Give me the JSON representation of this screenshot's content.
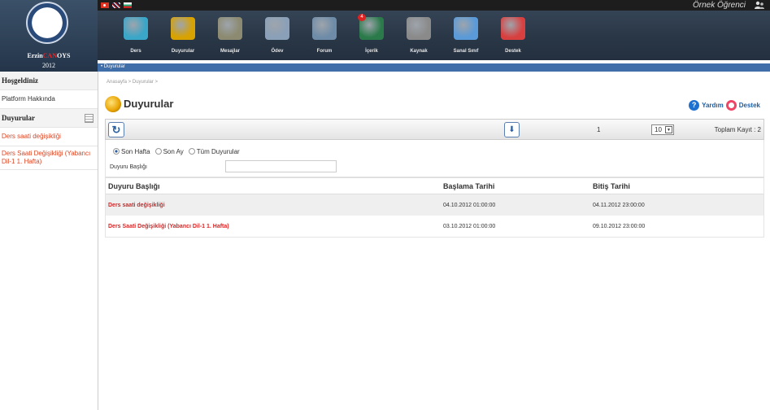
{
  "user": {
    "name": "Örnek Öğrenci"
  },
  "logo": {
    "title_prefix": "Erzin",
    "title_accent": "CAN",
    "title_suffix": "OYS",
    "year": "2012"
  },
  "nav": [
    {
      "label": "Ders",
      "icon": "abc-icon",
      "color": "#3aa6c8"
    },
    {
      "label": "Duyurular",
      "icon": "megaphone-icon",
      "color": "#d8a200"
    },
    {
      "label": "Mesajlar",
      "icon": "mail-icon",
      "color": "#8c8a70"
    },
    {
      "label": "Ödev",
      "icon": "assignment-icon",
      "color": "#8aa0b8"
    },
    {
      "label": "Forum",
      "icon": "forum-icon",
      "color": "#6e8ca8"
    },
    {
      "label": "İçerik",
      "icon": "blackboard-icon",
      "color": "#2a7a4a",
      "badge": "4"
    },
    {
      "label": "Kaynak",
      "icon": "books-icon",
      "color": "#8a8a8a"
    },
    {
      "label": "Sanal Sınıf",
      "icon": "virtual-class-icon",
      "color": "#5a9ad8"
    },
    {
      "label": "Destek",
      "icon": "lifebuoy-icon",
      "color": "#d84040"
    }
  ],
  "subnav": {
    "active": "Duyurular"
  },
  "sidebar": {
    "welcome": "Hoşgeldiniz",
    "about": "Platform Hakkında",
    "announcements_heading": "Duyurular",
    "items": [
      "Ders saati değişikliği",
      "Ders Saati Değişikliği (Yabancı Dil-1 1. Hafta)"
    ]
  },
  "breadcrumb": "Anasayfa > Duyurular >",
  "page_title": "Duyurular",
  "help": {
    "help_label": "Yardım",
    "support_label": "Destek"
  },
  "toolbar": {
    "page_number": "1",
    "page_size": "10",
    "total": "Toplam Kayıt : 2"
  },
  "filters": {
    "options": [
      "Son Hafta",
      "Son Ay",
      "Tüm Duyurular"
    ],
    "selected": 0,
    "title_label": "Duyuru Başlığı",
    "title_value": ""
  },
  "table": {
    "headers": [
      "Duyuru Başlığı",
      "Başlama Tarihi",
      "Bitiş Tarihi"
    ],
    "rows": [
      [
        "Ders saati değişikliği",
        "04.10.2012 01:00:00",
        "04.11.2012 23:00:00"
      ],
      [
        "Ders Saati Değişikliği (Yabancı Dil-1 1. Hafta)",
        "03.10.2012 01:00:00",
        "09.10.2012 23:00:00"
      ]
    ]
  }
}
